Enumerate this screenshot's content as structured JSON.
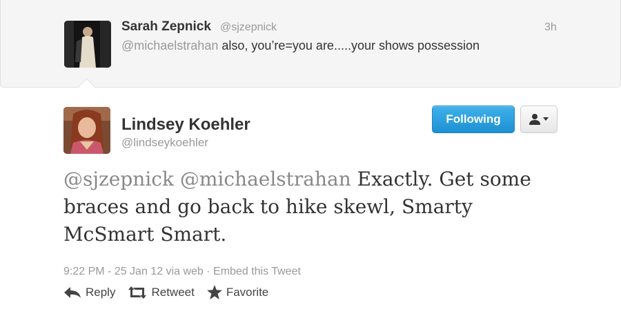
{
  "reply_to": {
    "name": "Sarah Zepnick",
    "handle": "@sjzepnick",
    "time": "3h",
    "mention": "@michaelstrahan",
    "text": " also, you’re=you are.....your shows possession",
    "avatar_icon": "user-photo-icon"
  },
  "tweet": {
    "name": "Lindsey Koehler",
    "handle": "@lindseykoehler",
    "mention1": "@sjzepnick",
    "mention2": "@michaelstrahan",
    "text": " Exactly. Get some braces and go back to hike skewl, Smarty McSmart Smart.",
    "timestamp": "9:22 PM - 25 Jan 12",
    "via": "via web",
    "separator": "·",
    "embed_label": "Embed this Tweet"
  },
  "buttons": {
    "follow_label": "Following",
    "user_menu_icon": "user-dropdown-icon"
  },
  "actions": {
    "reply_label": "Reply",
    "retweet_label": "Retweet",
    "favorite_label": "Favorite"
  },
  "colors": {
    "accent": "#2c9fe0",
    "muted": "#999999",
    "text": "#333333"
  }
}
